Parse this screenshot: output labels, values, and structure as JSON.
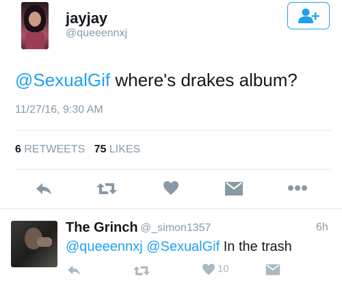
{
  "tweet": {
    "display_name": "jayjay",
    "handle": "@queeennxj",
    "mention": "@SexualGif",
    "text": " where's drakes album?",
    "timestamp": "11/27/16, 9:30 AM",
    "retweet_count": "6",
    "retweet_label": "RETWEETS",
    "like_count": "75",
    "like_label": "LIKES"
  },
  "reply": {
    "display_name": "The Grinch",
    "handle": "@_simon1357",
    "time": "6h",
    "mention1": "@queeennxj",
    "mention2": "@SexualGif",
    "text": " In the trash",
    "like_count": "10"
  },
  "icons": {
    "follow": "add-user-icon",
    "reply": "reply-arrow-icon",
    "retweet": "retweet-icon",
    "like": "heart-icon",
    "message": "direct-message-icon",
    "more": "more-dots-icon"
  },
  "colors": {
    "accent": "#1da1f2",
    "primary_text": "#14171a",
    "secondary_text": "#8899a6",
    "action_icon": "#8899a6",
    "reply_action_icon": "#aab8c2",
    "divider": "#e1e8ed"
  }
}
